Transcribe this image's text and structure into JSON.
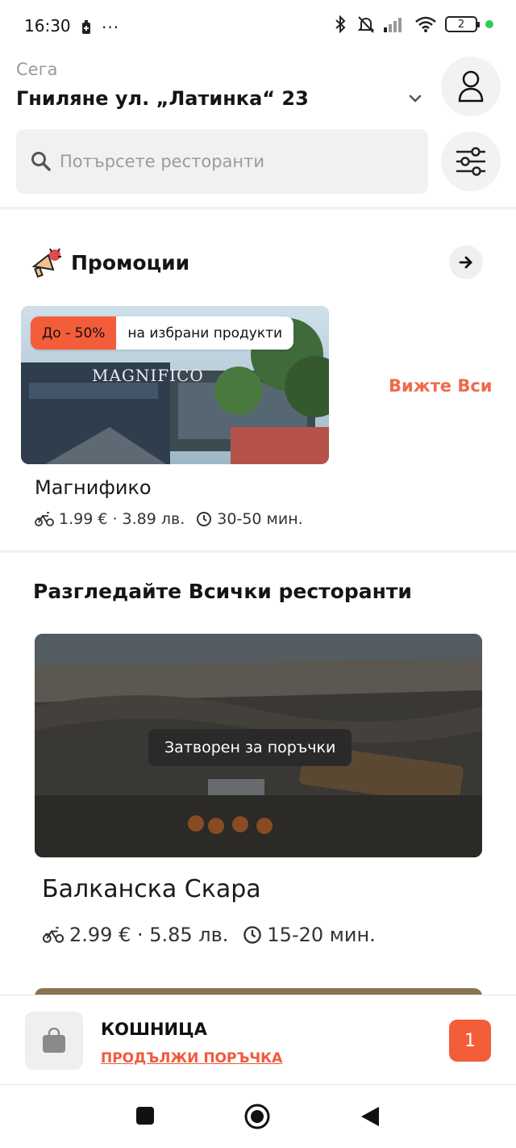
{
  "status_bar": {
    "time": "16:30",
    "dots": "···",
    "battery_level": "2"
  },
  "header": {
    "location_caption": "Сега",
    "location_address": "Гниляне ул. „Латинка“ 23"
  },
  "search": {
    "placeholder": "Потърсете ресторанти"
  },
  "promotions": {
    "title": "Промоции",
    "see_all": "Вижте Всич",
    "card": {
      "badge_discount": "До - 50%",
      "badge_text": "на избрани продукти",
      "name": "Магнифико",
      "delivery_fee": "1.99 € · 3.89 лв.",
      "delivery_time": "30-50 мин.",
      "image_sign": "MAGNIFICO"
    }
  },
  "restaurants": {
    "title": "Разгледайте Всички ресторанти",
    "items": [
      {
        "closed_label": "Затворен за поръчки",
        "name": "Балканска Скара",
        "delivery_fee": "2.99 € · 5.85 лв.",
        "delivery_time": "15-20 мин."
      }
    ]
  },
  "cart": {
    "title": "КОШНИЦА",
    "continue_label": "ПРОДЪЛЖИ ПОРЪЧКА",
    "count": "1"
  },
  "colors": {
    "accent": "#f45d3a",
    "link": "#ee6a4b",
    "surface": "#f1f1f1"
  }
}
